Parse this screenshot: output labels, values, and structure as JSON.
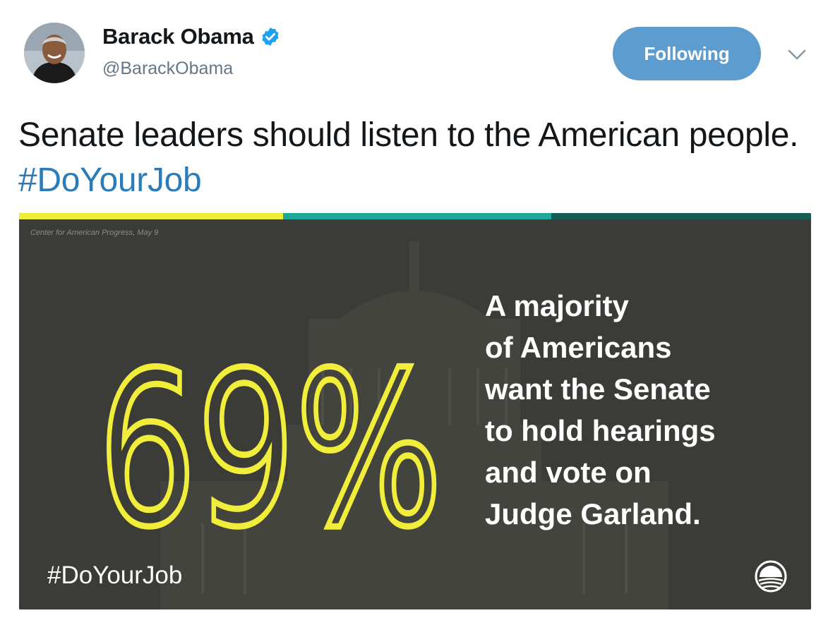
{
  "author": {
    "display_name": "Barack Obama",
    "handle": "@BarackObama",
    "verified": true
  },
  "follow_button": {
    "label": "Following",
    "color": "#5d9ccf"
  },
  "icons": {
    "verified": "verified-badge-icon",
    "more": "chevron-down-icon",
    "logo": "obama-rising-sun-logo-icon"
  },
  "tweet": {
    "text": "Senate leaders should listen to the American people. ",
    "hashtag": "#DoYourJob",
    "link_color": "#2b7bb9"
  },
  "media": {
    "source": "Center for American Progress, May 9",
    "big_number": "69%",
    "headline_lines": [
      "A majority",
      "of Americans",
      "want the Senate",
      "to hold hearings",
      "and vote on",
      "Judge Garland."
    ],
    "hashtag": "#DoYourJob",
    "accent_colors": [
      "#f1ee3b",
      "#1ea79a",
      "#155c54"
    ]
  }
}
